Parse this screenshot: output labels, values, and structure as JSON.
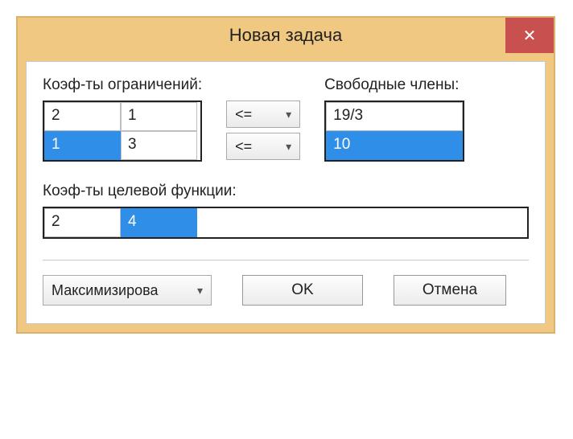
{
  "window": {
    "title": "Новая задача",
    "close_glyph": "✕"
  },
  "labels": {
    "constraints": "Коэф-ты ограничений:",
    "free": "Свободные члены:",
    "objective": "Коэф-ты целевой функции:"
  },
  "constraints": {
    "rows": [
      {
        "cells": [
          "2",
          "1"
        ],
        "selected_col": -1
      },
      {
        "cells": [
          "1",
          "3"
        ],
        "selected_col": 0
      }
    ]
  },
  "operators": [
    {
      "value": "<="
    },
    {
      "value": "<="
    }
  ],
  "free_members": {
    "rows": [
      {
        "value": "19/3",
        "selected": false
      },
      {
        "value": "10",
        "selected": true
      }
    ]
  },
  "objective": {
    "cells": [
      "2",
      "4"
    ],
    "selected_col": 1
  },
  "optimize": {
    "selected": "Максимизирова"
  },
  "buttons": {
    "ok": "OK",
    "cancel": "Отмена"
  },
  "chevron": "▾"
}
